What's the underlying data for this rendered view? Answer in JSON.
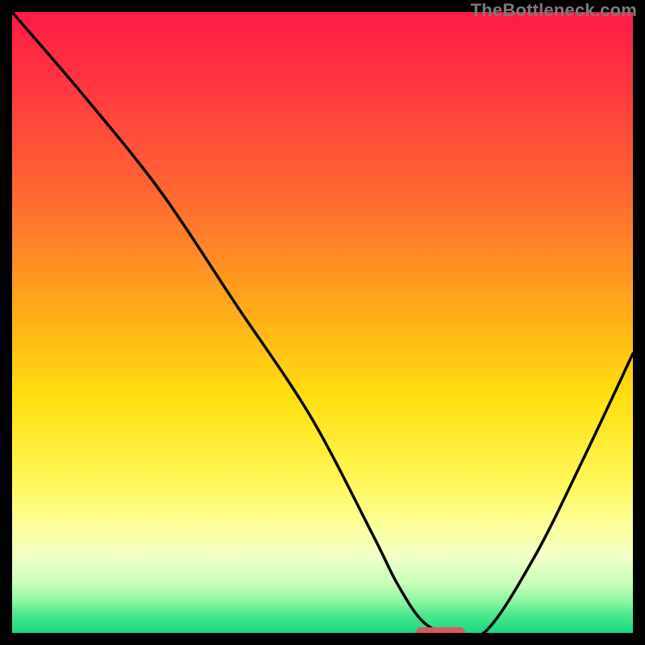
{
  "watermark": "TheBottleneck.com",
  "chart_data": {
    "type": "line",
    "title": "",
    "xlabel": "",
    "ylabel": "",
    "xlim": [
      0,
      100
    ],
    "ylim": [
      0,
      100
    ],
    "grid": false,
    "legend": false,
    "gradient_stops": [
      {
        "offset": 0,
        "color": "#ff1a46"
      },
      {
        "offset": 12,
        "color": "#ff3840"
      },
      {
        "offset": 30,
        "color": "#ff6a30"
      },
      {
        "offset": 50,
        "color": "#ffb218"
      },
      {
        "offset": 62,
        "color": "#ffe010"
      },
      {
        "offset": 76,
        "color": "#fff85a"
      },
      {
        "offset": 83,
        "color": "#fcff9e"
      },
      {
        "offset": 88,
        "color": "#f0ffc8"
      },
      {
        "offset": 92,
        "color": "#c8ffb8"
      },
      {
        "offset": 95,
        "color": "#8cf5a2"
      },
      {
        "offset": 97,
        "color": "#4de88e"
      },
      {
        "offset": 100,
        "color": "#17d981"
      }
    ],
    "series": [
      {
        "name": "curve",
        "x": [
          0,
          12,
          24,
          36,
          48,
          58,
          62,
          66,
          70,
          76,
          84,
          92,
          100
        ],
        "y": [
          100,
          86,
          71,
          53,
          35,
          16,
          8,
          2,
          0,
          0,
          12,
          28,
          45
        ]
      }
    ],
    "marker": {
      "x": 69,
      "y": 0,
      "width": 8,
      "color": "#d85a5f"
    }
  }
}
